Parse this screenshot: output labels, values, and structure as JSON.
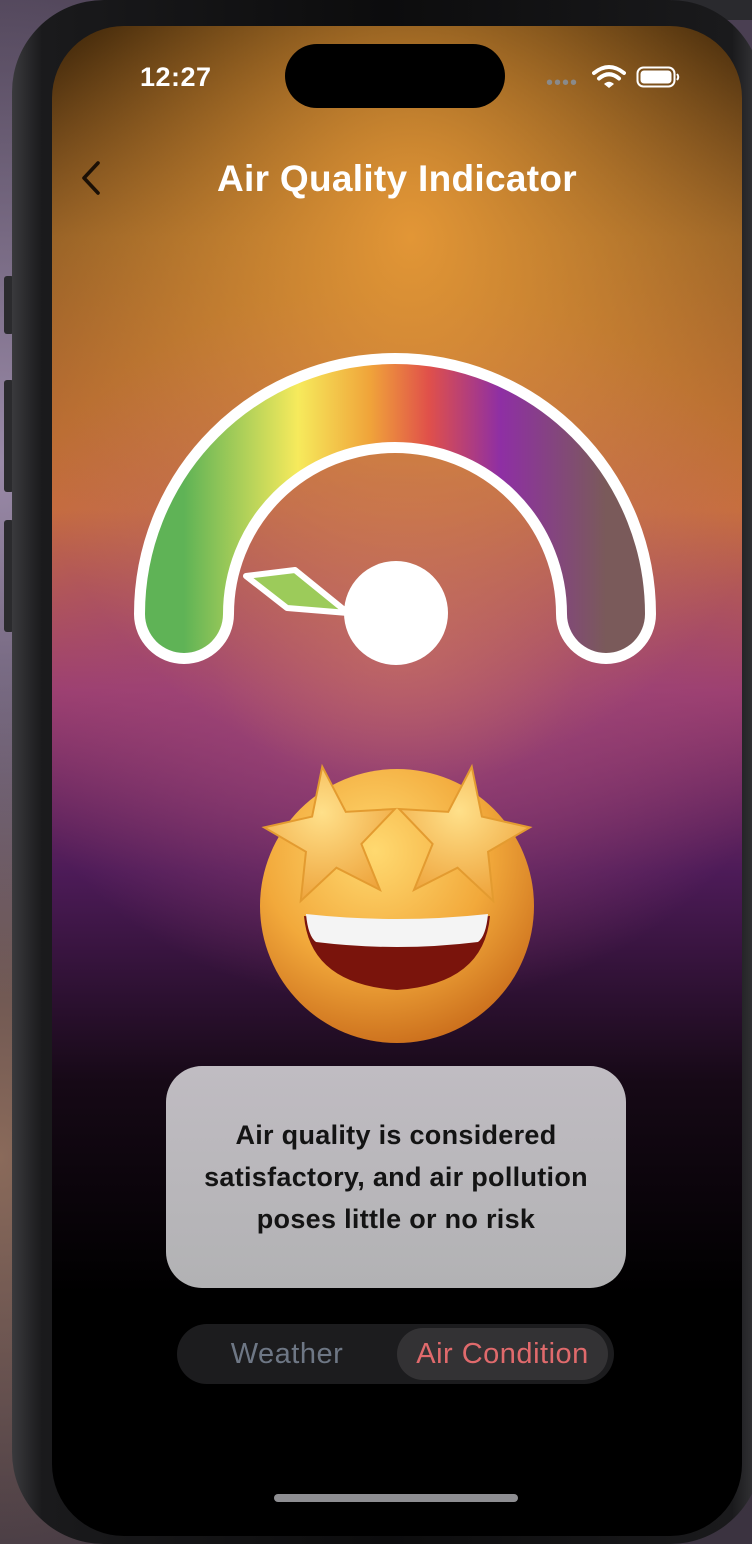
{
  "status_bar": {
    "time": "12:27"
  },
  "header": {
    "title": "Air Quality Indicator"
  },
  "gauge": {
    "colors": [
      "#5fb356",
      "#f6ea5c",
      "#f0a43a",
      "#e0504a",
      "#8e2fa4",
      "#7a5a5a"
    ],
    "needle_color": "#9ccb5a"
  },
  "message": {
    "text": "Air quality is considered satisfactory, and air pollution poses little or no risk"
  },
  "tabs": [
    {
      "label": "Weather",
      "selected": false
    },
    {
      "label": "Air Condition",
      "selected": true
    }
  ],
  "colors": {
    "tab_active": "#e06a6c",
    "tab_inactive": "#6e7785"
  },
  "icons": {
    "back": "chevron-left-icon",
    "wifi": "wifi-icon",
    "battery": "battery-icon",
    "emoji": "star-struck-emoji"
  }
}
